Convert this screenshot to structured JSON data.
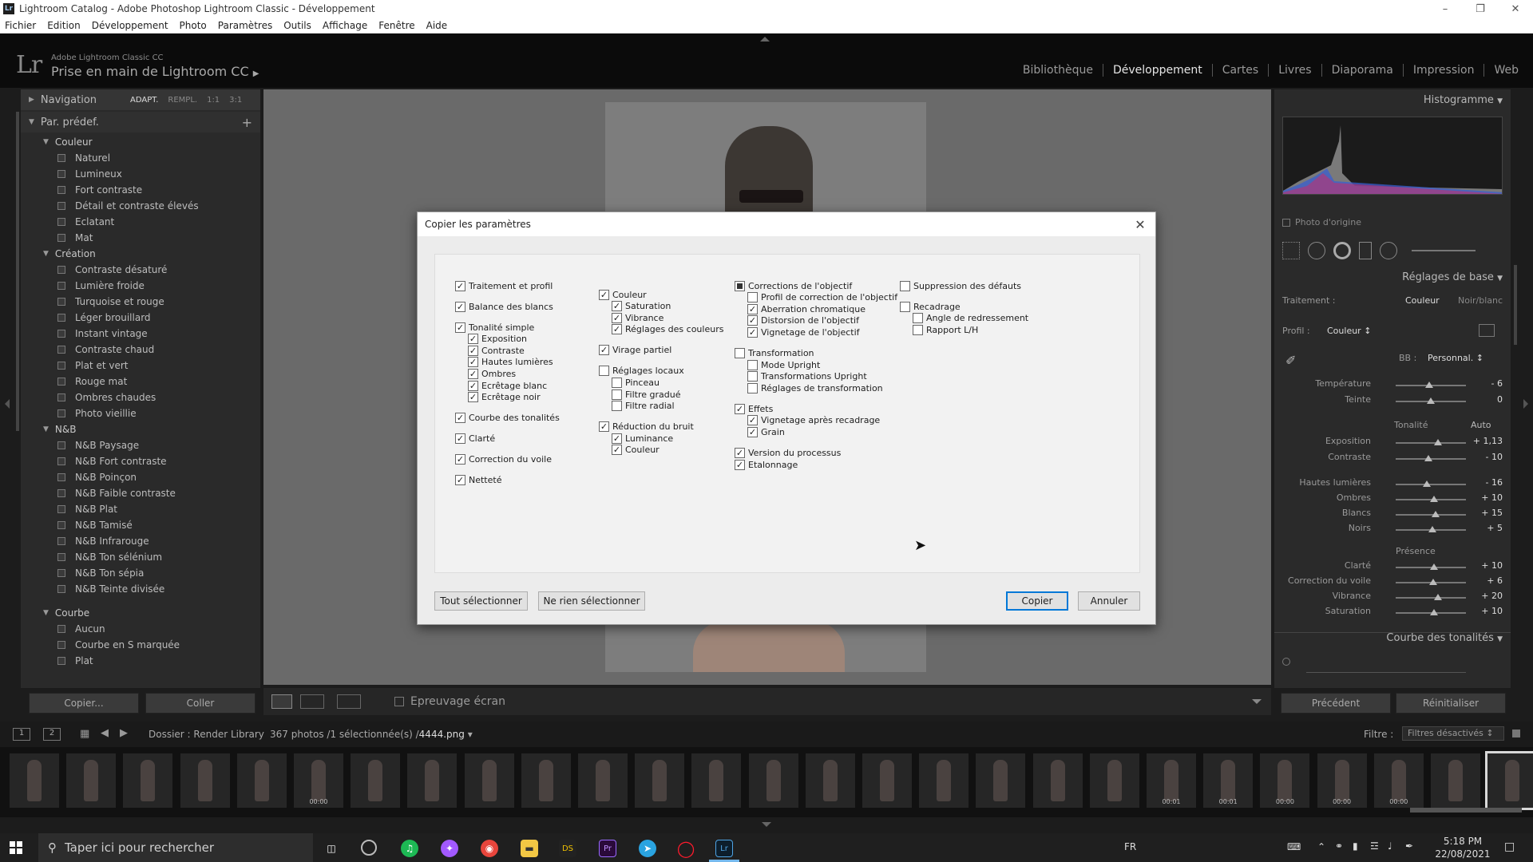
{
  "window": {
    "title": "Lightroom Catalog - Adobe Photoshop Lightroom Classic - Développement",
    "app_icon": "Lr"
  },
  "menu": [
    "Fichier",
    "Edition",
    "Développement",
    "Photo",
    "Paramètres",
    "Outils",
    "Affichage",
    "Fenêtre",
    "Aide"
  ],
  "identity": {
    "logo": "Lr",
    "product": "Adobe Lightroom Classic CC",
    "catalog": "Prise en main de Lightroom CC"
  },
  "modules": [
    "Bibliothèque",
    "Développement",
    "Cartes",
    "Livres",
    "Diaporama",
    "Impression",
    "Web"
  ],
  "left": {
    "navigation": "Navigation",
    "nav_opts": [
      "ADAPT.",
      "REMPL.",
      "1:1",
      "3:1"
    ],
    "presets_header": "Par. prédef.",
    "groups": [
      {
        "name": "Couleur",
        "items": [
          "Naturel",
          "Lumineux",
          "Fort contraste",
          "Détail et contraste élevés",
          "Eclatant",
          "Mat"
        ]
      },
      {
        "name": "Création",
        "items": [
          "Contraste désaturé",
          "Lumière froide",
          "Turquoise et rouge",
          "Léger brouillard",
          "Instant vintage",
          "Contraste chaud",
          "Plat et vert",
          "Rouge mat",
          "Ombres chaudes",
          "Photo vieillie"
        ]
      },
      {
        "name": "N&B",
        "items": [
          "N&B Paysage",
          "N&B Fort contraste",
          "N&B Poinçon",
          "N&B Faible contraste",
          "N&B Plat",
          "N&B Tamisé",
          "N&B Infrarouge",
          "N&B Ton sélénium",
          "N&B Ton sépia",
          "N&B Teinte divisée"
        ]
      },
      {
        "name": "Courbe",
        "items": [
          "Aucun",
          "Courbe en S marquée",
          "Plat"
        ]
      }
    ],
    "copy_btn": "Copier...",
    "paste_btn": "Coller"
  },
  "toolbar": {
    "proof_label": "Epreuvage écran"
  },
  "right": {
    "histogram": "Histogramme",
    "original": "Photo d'origine",
    "basic": "Réglages de base",
    "treatment_label": "Traitement :",
    "treatment_color": "Couleur",
    "treatment_bw": "Noir/blanc",
    "profile_label": "Profil :",
    "profile_value": "Couleur",
    "wb_label": "BB :",
    "wb_value": "Personnal.",
    "tonality": "Tonalité",
    "auto": "Auto",
    "presence": "Présence",
    "tone_curve": "Courbe des tonalités",
    "prev_btn": "Précédent",
    "reset_btn": "Réinitialiser",
    "sliders_wb": [
      {
        "label": "Température",
        "value": "- 6",
        "pos": 0.48
      },
      {
        "label": "Teinte",
        "value": "0",
        "pos": 0.5
      }
    ],
    "sliders_tone": [
      {
        "label": "Exposition",
        "value": "+ 1,13",
        "pos": 0.6
      },
      {
        "label": "Contraste",
        "value": "- 10",
        "pos": 0.47
      }
    ],
    "sliders_tone2": [
      {
        "label": "Hautes lumières",
        "value": "- 16",
        "pos": 0.44
      },
      {
        "label": "Ombres",
        "value": "+ 10",
        "pos": 0.55
      },
      {
        "label": "Blancs",
        "value": "+ 15",
        "pos": 0.57
      },
      {
        "label": "Noirs",
        "value": "+ 5",
        "pos": 0.52
      }
    ],
    "sliders_presence": [
      {
        "label": "Clarté",
        "value": "+ 10",
        "pos": 0.55
      },
      {
        "label": "Correction du voile",
        "value": "+ 6",
        "pos": 0.53
      },
      {
        "label": "Vibrance",
        "value": "+ 20",
        "pos": 0.6
      },
      {
        "label": "Saturation",
        "value": "+ 10",
        "pos": 0.55
      }
    ]
  },
  "filmbar": {
    "pages": [
      "1",
      "2"
    ],
    "folder": "Dossier : Render Library",
    "count": "367 photos /1 sélectionnée(s) /",
    "file": "4444.png",
    "filter_label": "Filtre :",
    "filter_value": "Filtres désactivés"
  },
  "film_durations": [
    "",
    "",
    "",
    "",
    "",
    "00:00",
    "",
    "",
    "",
    "",
    "",
    "",
    "",
    "",
    "",
    "",
    "",
    "",
    "",
    "",
    "00:01",
    "00:01",
    "00:00",
    "00:00",
    "00:00",
    "",
    ""
  ],
  "dialog": {
    "title": "Copier les paramètres",
    "select_all": "Tout sélectionner",
    "select_none": "Ne rien sélectionner",
    "copy": "Copier",
    "cancel": "Annuler",
    "columns": [
      [
        {
          "label": "Traitement et profil",
          "checked": true,
          "indent": 0,
          "gap": 0
        },
        {
          "label": "Balance des blancs",
          "checked": true,
          "indent": 0,
          "gap": 1
        },
        {
          "label": "Tonalité simple",
          "checked": true,
          "indent": 0,
          "gap": 1
        },
        {
          "label": "Exposition",
          "checked": true,
          "indent": 1,
          "gap": 0
        },
        {
          "label": "Contraste",
          "checked": true,
          "indent": 1,
          "gap": 0
        },
        {
          "label": "Hautes lumières",
          "checked": true,
          "indent": 1,
          "gap": 0
        },
        {
          "label": "Ombres",
          "checked": true,
          "indent": 1,
          "gap": 0
        },
        {
          "label": "Ecrêtage blanc",
          "checked": true,
          "indent": 1,
          "gap": 0
        },
        {
          "label": "Ecrêtage noir",
          "checked": true,
          "indent": 1,
          "gap": 0
        },
        {
          "label": "Courbe des tonalités",
          "checked": true,
          "indent": 0,
          "gap": 1
        },
        {
          "label": "Clarté",
          "checked": true,
          "indent": 0,
          "gap": 1
        },
        {
          "label": "Correction du voile",
          "checked": true,
          "indent": 0,
          "gap": 1
        },
        {
          "label": "Netteté",
          "checked": true,
          "indent": 0,
          "gap": 1
        }
      ],
      [
        {
          "label": "Couleur",
          "checked": true,
          "indent": 0,
          "gap": 0
        },
        {
          "label": "Saturation",
          "checked": true,
          "indent": 1,
          "gap": 0
        },
        {
          "label": "Vibrance",
          "checked": true,
          "indent": 1,
          "gap": 0
        },
        {
          "label": "Réglages des couleurs",
          "checked": true,
          "indent": 1,
          "gap": 0
        },
        {
          "label": "Virage partiel",
          "checked": true,
          "indent": 0,
          "gap": 1
        },
        {
          "label": "Réglages locaux",
          "checked": false,
          "indent": 0,
          "gap": 1
        },
        {
          "label": "Pinceau",
          "checked": false,
          "indent": 1,
          "gap": 0
        },
        {
          "label": "Filtre gradué",
          "checked": false,
          "indent": 1,
          "gap": 0
        },
        {
          "label": "Filtre radial",
          "checked": false,
          "indent": 1,
          "gap": 0
        },
        {
          "label": "Réduction du bruit",
          "checked": true,
          "indent": 0,
          "gap": 1
        },
        {
          "label": "Luminance",
          "checked": true,
          "indent": 1,
          "gap": 0
        },
        {
          "label": "Couleur",
          "checked": true,
          "indent": 1,
          "gap": 0
        }
      ],
      [
        {
          "label": "Corrections de l'objectif",
          "checked": "partial",
          "indent": 0,
          "gap": 0
        },
        {
          "label": "Profil de correction de l'objectif",
          "checked": false,
          "indent": 1,
          "gap": 0
        },
        {
          "label": "Aberration chromatique",
          "checked": true,
          "indent": 1,
          "gap": 0
        },
        {
          "label": "Distorsion de l'objectif",
          "checked": true,
          "indent": 1,
          "gap": 0
        },
        {
          "label": "Vignetage de l'objectif",
          "checked": true,
          "indent": 1,
          "gap": 0
        },
        {
          "label": "Transformation",
          "checked": false,
          "indent": 0,
          "gap": 1
        },
        {
          "label": "Mode Upright",
          "checked": false,
          "indent": 1,
          "gap": 0
        },
        {
          "label": "Transformations Upright",
          "checked": false,
          "indent": 1,
          "gap": 0
        },
        {
          "label": "Réglages de transformation",
          "checked": false,
          "indent": 1,
          "gap": 0
        },
        {
          "label": "Effets",
          "checked": true,
          "indent": 0,
          "gap": 1
        },
        {
          "label": "Vignetage après recadrage",
          "checked": true,
          "indent": 1,
          "gap": 0
        },
        {
          "label": "Grain",
          "checked": true,
          "indent": 1,
          "gap": 0
        },
        {
          "label": "Version du processus",
          "checked": true,
          "indent": 0,
          "gap": 1
        },
        {
          "label": "Etalonnage",
          "checked": true,
          "indent": 0,
          "gap": 0
        }
      ],
      [
        {
          "label": "Suppression des défauts",
          "checked": false,
          "indent": 0,
          "gap": 0
        },
        {
          "label": "Recadrage",
          "checked": false,
          "indent": 0,
          "gap": 1
        },
        {
          "label": "Angle de redressement",
          "checked": false,
          "indent": 1,
          "gap": 0
        },
        {
          "label": "Rapport L/H",
          "checked": false,
          "indent": 1,
          "gap": 0
        }
      ]
    ]
  },
  "taskbar": {
    "search_placeholder": "Taper ici pour rechercher",
    "lang": "FR",
    "time": "5:18 PM",
    "date": "22/08/2021"
  }
}
